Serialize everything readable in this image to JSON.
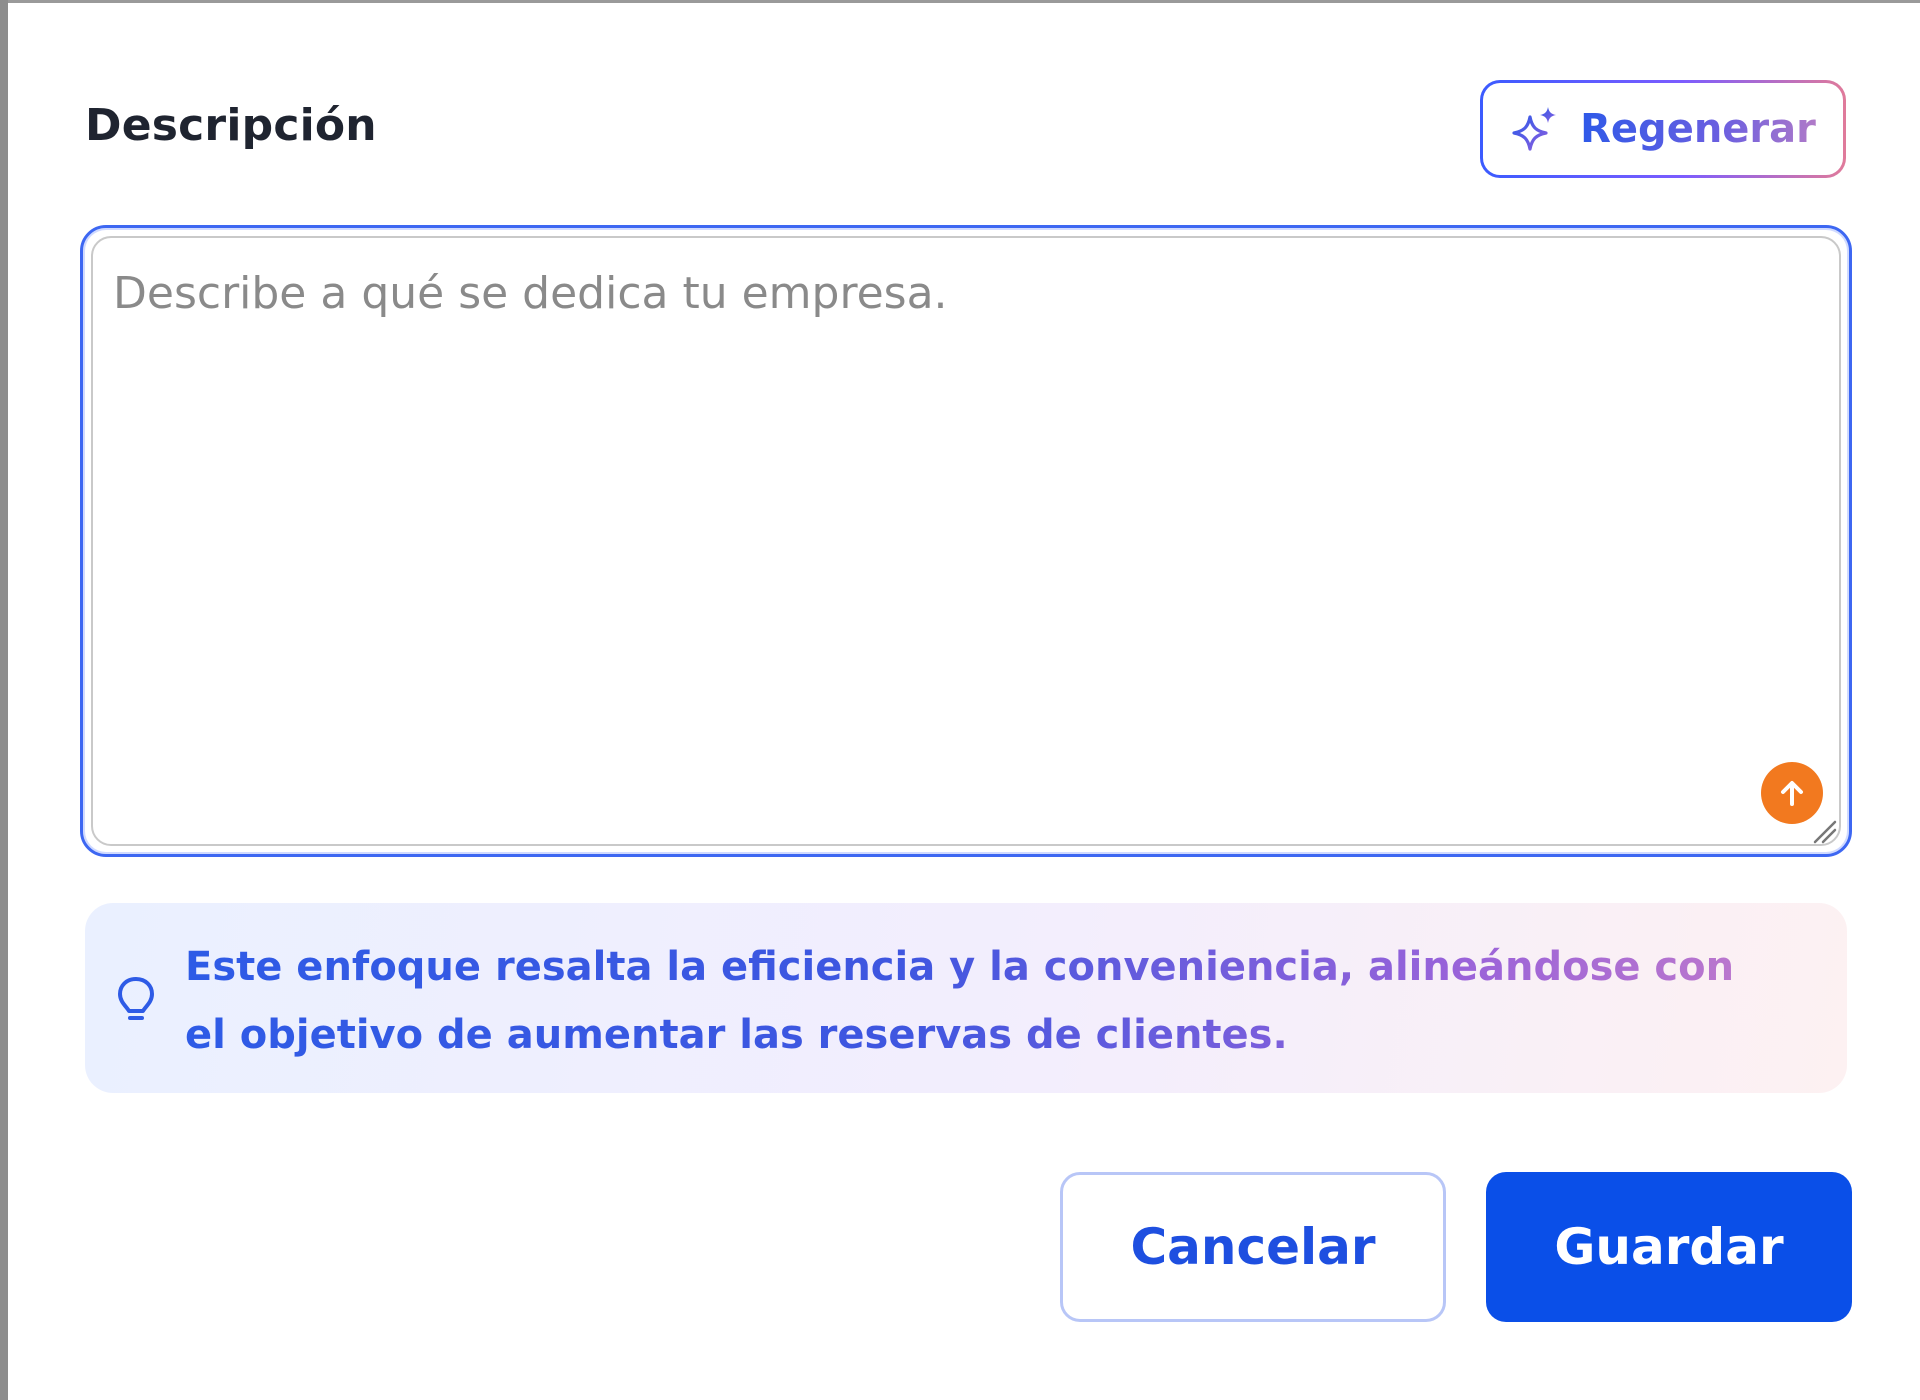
{
  "section": {
    "title": "Descripción"
  },
  "regenerate_button": {
    "label": "Regenerar",
    "icon": "sparkle-icon"
  },
  "description_field": {
    "value": "",
    "placeholder": "Describe a qué se dedica tu empresa.",
    "upload_icon": "arrow-up-circle-icon"
  },
  "tip": {
    "icon": "lightbulb-icon",
    "text": "Este enfoque resalta la eficiencia y la conveniencia, alineándose con el objetivo de aumentar las reservas de clientes."
  },
  "actions": {
    "cancel_label": "Cancelar",
    "save_label": "Guardar"
  },
  "colors": {
    "primary": "#0a4fe8",
    "focus_border": "#3d67f2",
    "upload_orange": "#f2791f",
    "cancel_border": "#b8c6f7"
  }
}
